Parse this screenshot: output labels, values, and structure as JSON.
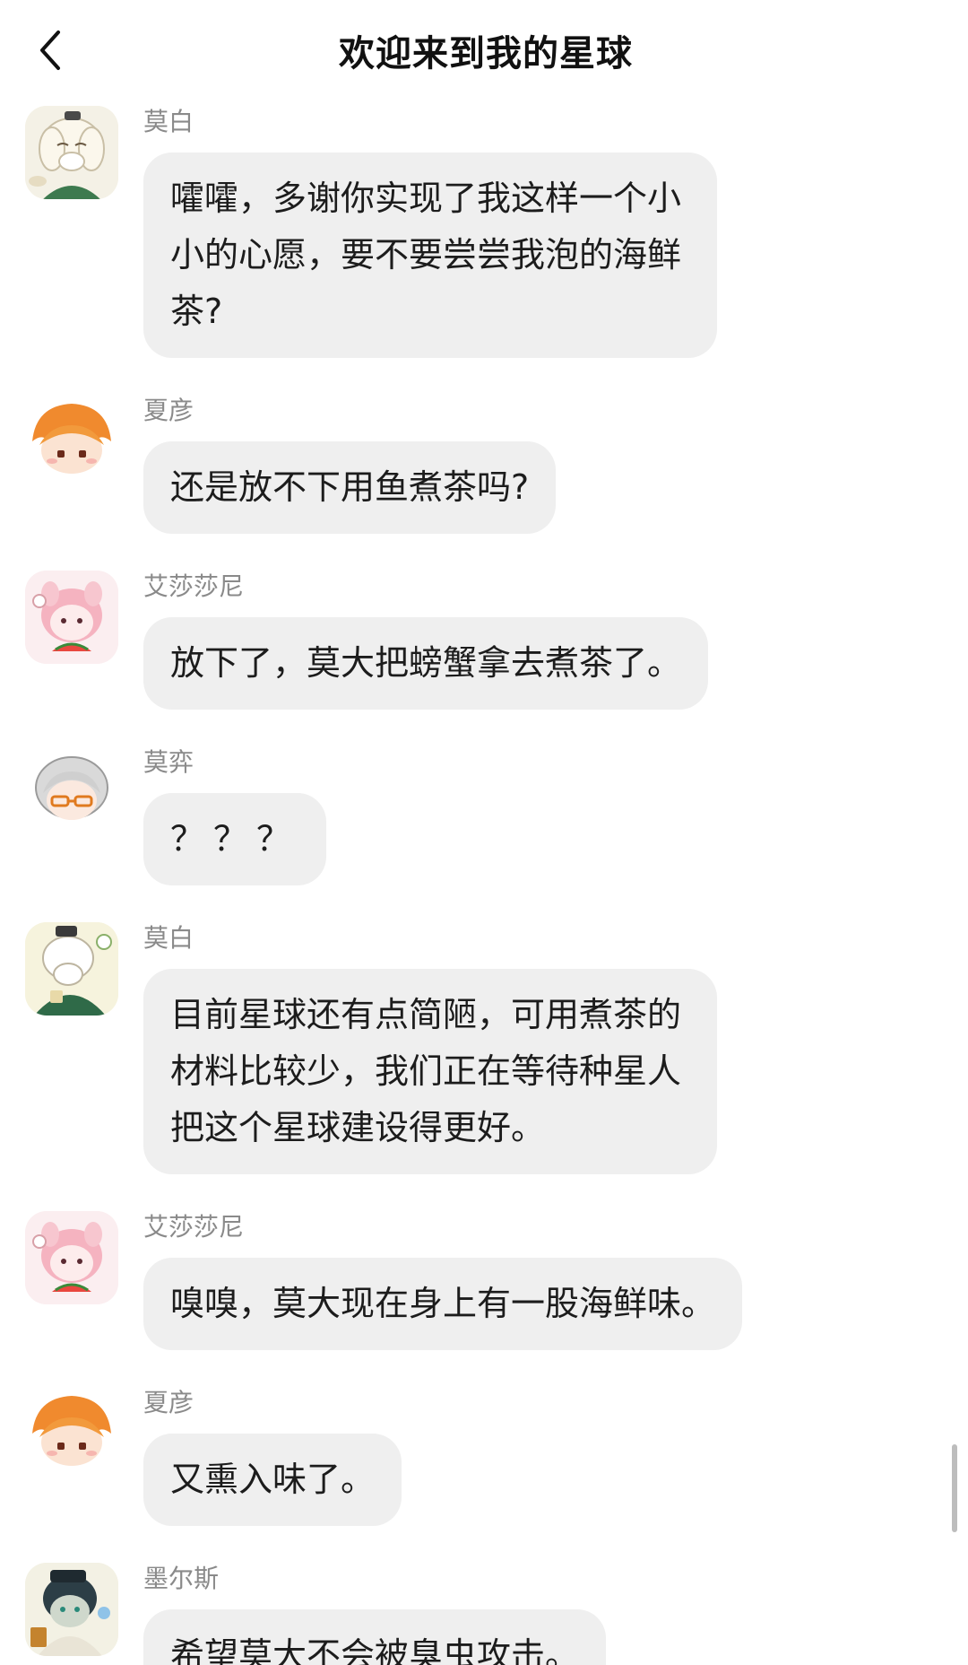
{
  "header": {
    "title": "欢迎来到我的星球"
  },
  "messages": [
    {
      "sender": "莫白",
      "text": "嚯嚯，多谢你实现了我这样一个小小的心愿，要不要尝尝我泡的海鲜茶?"
    },
    {
      "sender": "夏彦",
      "text": "还是放不下用鱼煮茶吗?"
    },
    {
      "sender": "艾莎莎尼",
      "text": "放下了，莫大把螃蟹拿去煮茶了。"
    },
    {
      "sender": "莫弈",
      "text": "？？？"
    },
    {
      "sender": "莫白",
      "text": "目前星球还有点简陋，可用煮茶的材料比较少，我们正在等待种星人把这个星球建设得更好。"
    },
    {
      "sender": "艾莎莎尼",
      "text": "嗅嗅，莫大现在身上有一股海鲜味。"
    },
    {
      "sender": "夏彦",
      "text": "又熏入味了。"
    },
    {
      "sender": "墨尔斯",
      "text": "希望莫大不会被臭虫攻击。"
    }
  ],
  "icons": {
    "back": "chevron-left-icon"
  }
}
